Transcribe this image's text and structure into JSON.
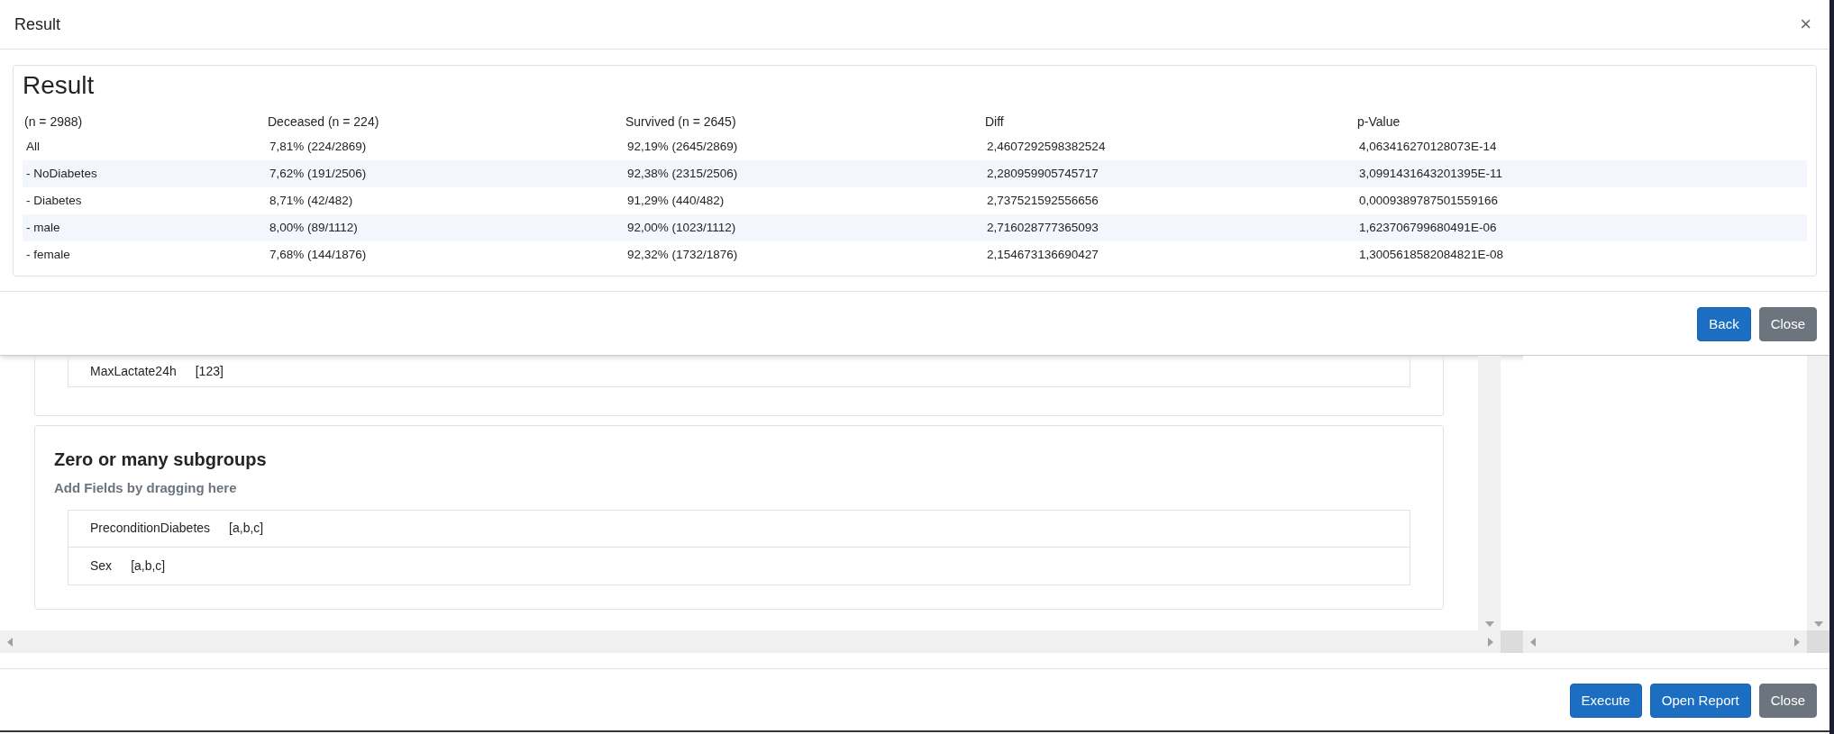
{
  "modal": {
    "title": "Result",
    "close": "×"
  },
  "result_card": {
    "heading": "Result",
    "columns": [
      "(n = 2988)",
      "Deceased (n = 224)",
      "Survived (n = 2645)",
      "Diff",
      "p-Value"
    ],
    "rows": [
      {
        "cells": [
          "All",
          "7,81% (224/2869)",
          "92,19% (2645/2869)",
          "2,4607292598382524",
          "4,063416270128073E-14"
        ]
      },
      {
        "cells": [
          "- NoDiabetes",
          "7,62% (191/2506)",
          "92,38% (2315/2506)",
          "2,280959905745717",
          "3,0991431643201395E-11"
        ]
      },
      {
        "cells": [
          "- Diabetes",
          "8,71% (42/482)",
          "91,29% (440/482)",
          "2,737521592556656",
          "0,0009389787501559166"
        ]
      },
      {
        "cells": [
          "- male",
          "8,00% (89/1112)",
          "92,00% (1023/1112)",
          "2,716028777365093",
          "1,623706799680491E-06"
        ]
      },
      {
        "cells": [
          "- female",
          "7,68% (144/1876)",
          "92,32% (1732/1876)",
          "2,154673136690427",
          "1,3005618582084821E-08"
        ]
      }
    ]
  },
  "modal_buttons": [
    {
      "label": "Back",
      "kind": "primary"
    },
    {
      "label": "Close",
      "kind": "secondary"
    }
  ],
  "fields_card": {
    "items": [
      {
        "name": "MaxLactate24h",
        "type": "[123]"
      }
    ]
  },
  "subgroups_card": {
    "title": "Zero or many subgroups",
    "hint": "Add Fields by dragging here",
    "items": [
      {
        "name": "PreconditionDiabetes",
        "type": "[a,b,c]"
      },
      {
        "name": "Sex",
        "type": "[a,b,c]"
      }
    ]
  },
  "page_buttons": [
    {
      "label": "Execute",
      "kind": "primary"
    },
    {
      "label": "Open Report",
      "kind": "primary"
    },
    {
      "label": "Close",
      "kind": "secondary"
    }
  ]
}
